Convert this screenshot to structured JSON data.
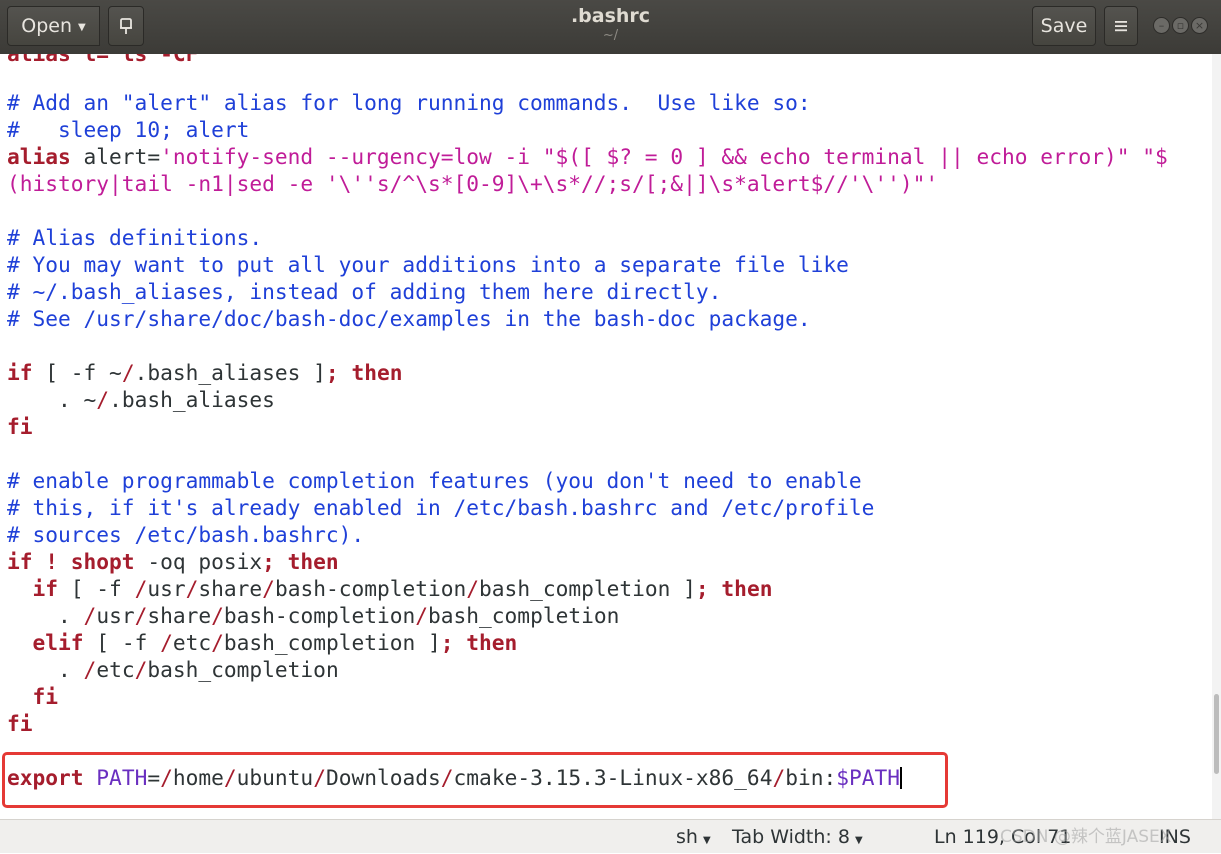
{
  "header": {
    "open_label": "Open",
    "title": ".bashrc",
    "subtitle": "~/",
    "save_label": "Save"
  },
  "editor": {
    "partial_top_line": "alias l='ls -CF'",
    "lines": [
      "# Add an \"alert\" alias for long running commands.  Use like so:",
      "#   sleep 10; alert",
      "alias",
      " alert=",
      "'notify-send --urgency=low -i \"$([ $? = 0 ] && echo terminal || echo error)\" \"$",
      "(history|tail -n1|sed -e '\\''s/^\\s*[0-9]\\+\\s*//;s/[;&|]\\s*alert$//'\\'')\"'",
      "# Alias definitions.",
      "# You may want to put all your additions into a separate file like",
      "# ~/.bash_aliases, instead of adding them here directly.",
      "# See /usr/share/doc/bash-doc/examples in the bash-doc package.",
      "if",
      " [ -f ~",
      "/",
      ".bash_aliases ]",
      ";",
      " then",
      "    . ~",
      "/",
      ".bash_aliases",
      "fi",
      "# enable programmable completion features (you don't need to enable",
      "# this, if it's already enabled in /etc/bash.bashrc and /etc/profile",
      "# sources /etc/bash.bashrc).",
      "if",
      " !",
      " shopt",
      " -oq posix",
      ";",
      " then",
      "  if",
      " [ -f ",
      "/",
      "usr",
      "/",
      "share",
      "/",
      "bash-completion",
      "/",
      "bash_completion ]",
      ";",
      " then",
      "    . ",
      "/",
      "usr",
      "/",
      "share",
      "/",
      "bash-completion",
      "/",
      "bash_completion",
      "  elif",
      " [ -f ",
      "/",
      "etc",
      "/",
      "bash_completion ]",
      ";",
      " then",
      "    . ",
      "/",
      "etc",
      "/",
      "bash_completion",
      "  fi",
      "fi",
      "export",
      " PATH",
      "=",
      "/",
      "home",
      "/",
      "ubuntu",
      "/",
      "Downloads",
      "/",
      "cmake-3.15.3-Linux-x86_64",
      "/",
      "bin:",
      "$PATH"
    ]
  },
  "statusbar": {
    "language": "sh",
    "tab_width": "Tab Width: 8",
    "position": "Ln 119, Col 71",
    "mode": "INS",
    "watermark": "CSDN @辣个蓝JASEX"
  },
  "colors": {
    "comment": "#1f40d8",
    "keyword": "#a51d2d",
    "string": "#c01c98",
    "variable": "#6a2fc0",
    "highlight_box": "#e53935"
  },
  "icons": {
    "pin": "pin-icon",
    "menu": "hamburger-menu-icon",
    "chevron": "chevron-down-icon"
  }
}
